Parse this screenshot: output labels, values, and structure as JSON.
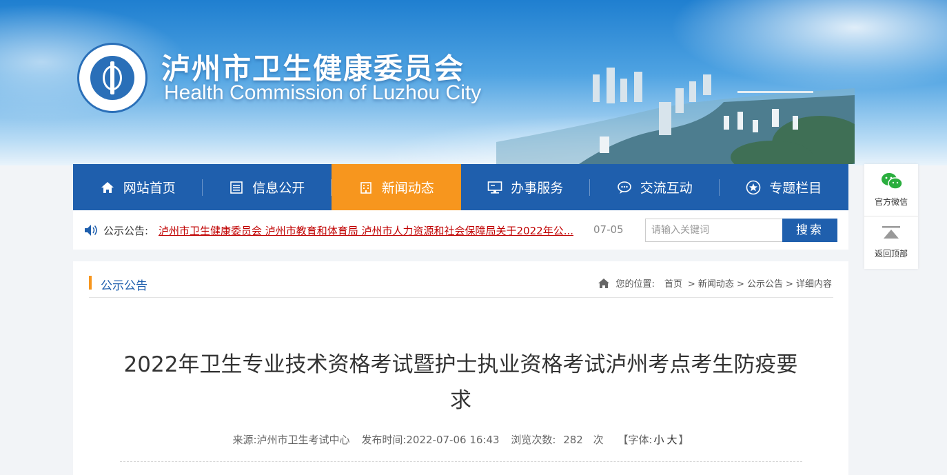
{
  "header": {
    "site_name_cn": "泸州市卫生健康委员会",
    "site_name_en": "Health Commission of Luzhou City"
  },
  "nav": {
    "items": [
      {
        "label": "网站首页",
        "icon": "home-icon"
      },
      {
        "label": "信息公开",
        "icon": "document-list-icon"
      },
      {
        "label": "新闻动态",
        "icon": "building-icon",
        "active": true
      },
      {
        "label": "办事服务",
        "icon": "monitor-icon"
      },
      {
        "label": "交流互动",
        "icon": "chat-bubble-icon"
      },
      {
        "label": "专题栏目",
        "icon": "star-circle-icon"
      }
    ]
  },
  "notice": {
    "label": "公示公告:",
    "text": "泸州市卫生健康委员会 泸州市教育和体育局 泸州市人力资源和社会保障局关于2022年公...",
    "date": "07-05"
  },
  "search": {
    "placeholder": "请输入关键词",
    "button_label": "搜索"
  },
  "side": {
    "wechat_label": "官方微信",
    "top_label": "返回顶部"
  },
  "section": {
    "title": "公示公告",
    "breadcrumb_prefix": "您的位置:",
    "breadcrumb": [
      "首页",
      "> 新闻动态",
      "> 公示公告",
      "> 详细内容"
    ]
  },
  "article": {
    "title": "2022年卫生专业技术资格考试暨护士执业资格考试泸州考点考生防疫要求",
    "source": "来源:泸州市卫生考试中心",
    "publish_time": "发布时间:2022-07-06 16:43",
    "views_label": "浏览次数:",
    "views": "282",
    "views_unit": "次",
    "font_open": "【字体:",
    "font_small": "小",
    "font_large": "大",
    "font_close": "】"
  },
  "colors": {
    "nav_bg": "#1f5fad",
    "nav_active": "#f7961e",
    "notice_link": "#c00000",
    "wechat_green": "#2aae3e"
  }
}
